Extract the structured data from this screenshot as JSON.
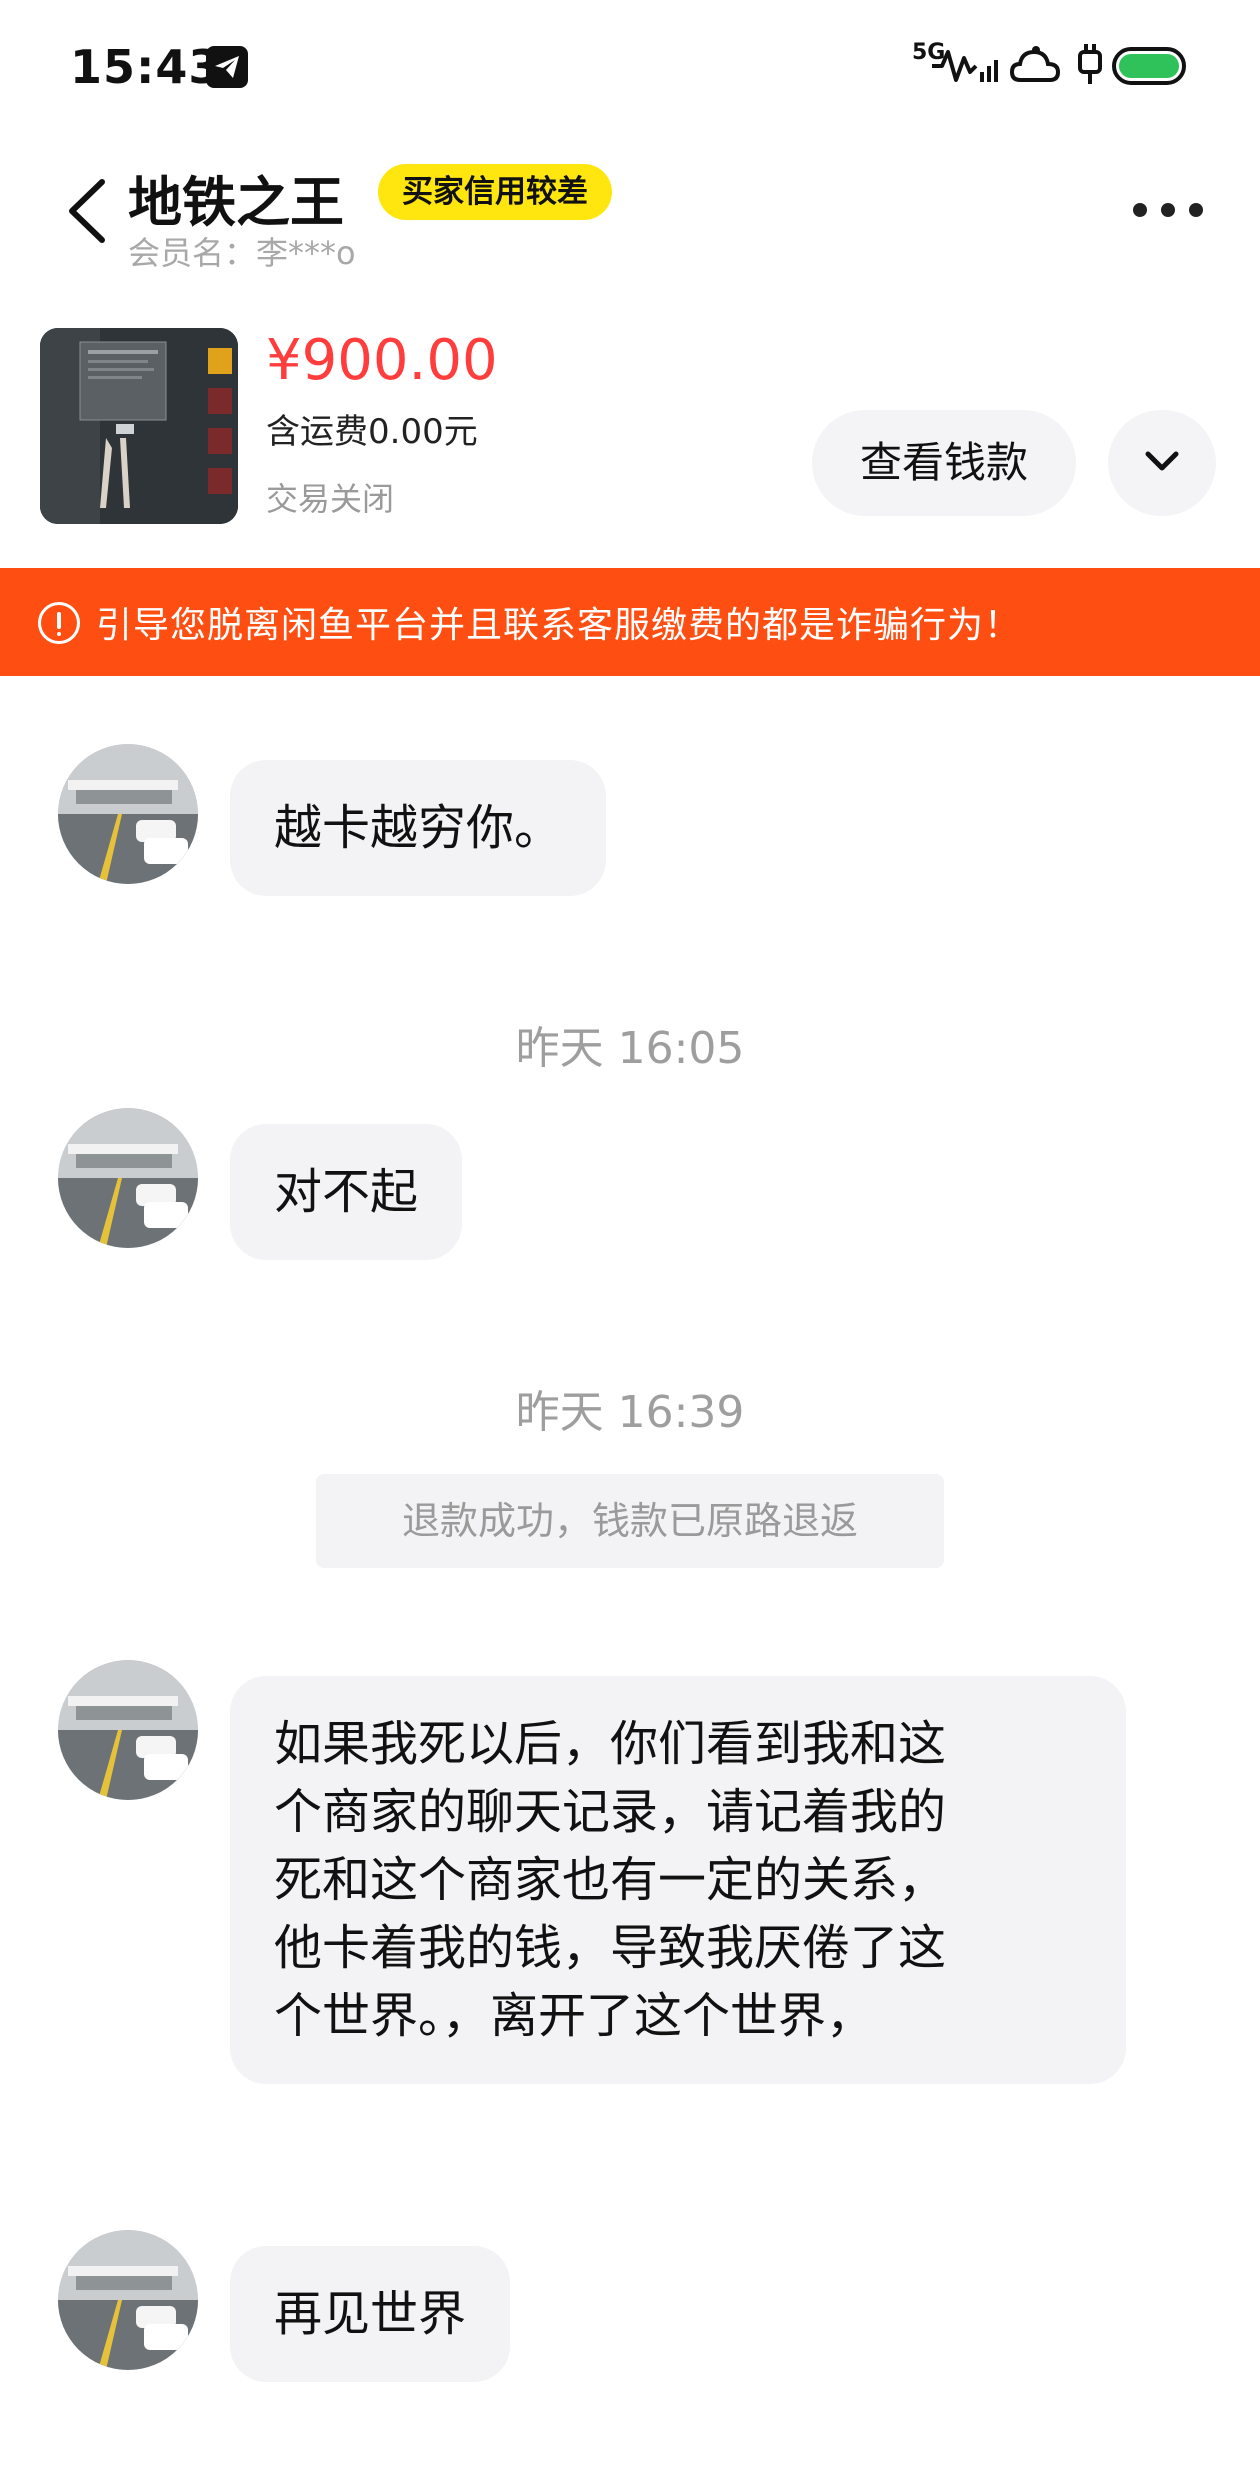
{
  "status_bar": {
    "time": "15:43",
    "network": "5G",
    "icons": [
      "telegram-icon",
      "signal-wave-icon",
      "cloud-sync-icon",
      "charging-plug-icon",
      "battery-icon"
    ],
    "battery_color": "#2fc25b"
  },
  "header": {
    "shop_name": "地铁之王",
    "credit_badge": "买家信用较差",
    "member_label": "会员名：李***o"
  },
  "product": {
    "price": "¥900.00",
    "shipping": "含运费0.00元",
    "status": "交易关闭",
    "view_money_button": "查看钱款"
  },
  "warning": {
    "text": "引导您脱离闲鱼平台并且联系客服缴费的都是诈骗行为！"
  },
  "messages": {
    "m1": "越卡越穷你。",
    "ts1": "昨天 16:05",
    "m2": "对不起",
    "ts2": "昨天 16:39",
    "system": "退款成功，钱款已原路退返",
    "m3_lines": [
      "如果我死以后，你们看到我和这",
      "个商家的聊天记录，请记着我的",
      "死和这个商家也有一定的关系，",
      "他卡着我的钱，导致我厌倦了这",
      "个世界。，离开了这个世界，"
    ],
    "m4": "再见世界"
  },
  "colors": {
    "accent_red": "#ff3d3d",
    "warning_orange": "#ff4e12",
    "badge_yellow": "#ffe60f",
    "bubble_gray": "#f3f3f5"
  }
}
